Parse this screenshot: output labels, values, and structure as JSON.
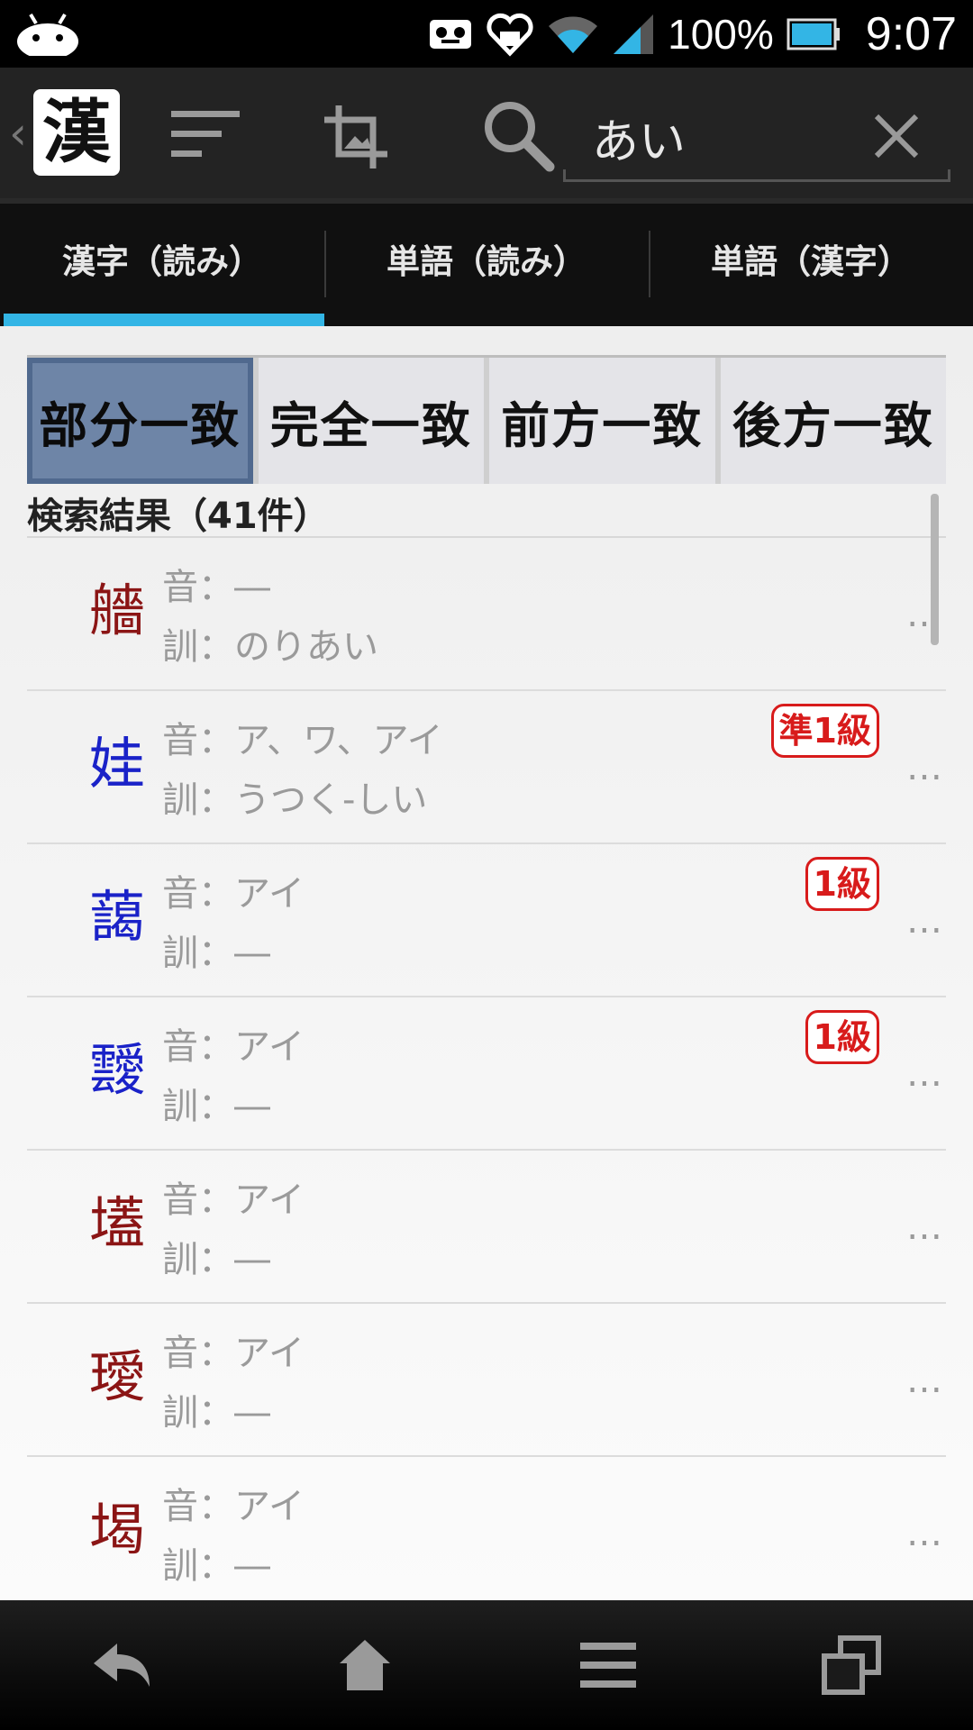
{
  "status_bar": {
    "battery_percent": "100%",
    "time": "9:07"
  },
  "action_bar": {
    "app_logo_char": "漢",
    "search": {
      "value": "あい"
    }
  },
  "tabs": [
    {
      "label": "漢字（読み）",
      "active": true
    },
    {
      "label": "単語（読み）",
      "active": false
    },
    {
      "label": "単語（漢字）",
      "active": false
    }
  ],
  "match_modes": [
    {
      "label": "部分一致",
      "selected": true
    },
    {
      "label": "完全一致",
      "selected": false
    },
    {
      "label": "前方一致",
      "selected": false
    },
    {
      "label": "後方一致",
      "selected": false
    }
  ],
  "results": {
    "count_label": "検索結果（41件）",
    "on_prefix": "音：",
    "kun_prefix": "訓：",
    "more_label": "…",
    "items": [
      {
        "kanji": "艢",
        "kanji_color": "red",
        "on": "―",
        "kun": "のりあい",
        "grade": ""
      },
      {
        "kanji": "娃",
        "kanji_color": "blue",
        "on": "ア、ワ、アイ",
        "kun": "うつく-しい",
        "grade": "準1級"
      },
      {
        "kanji": "藹",
        "kanji_color": "blue",
        "on": "アイ",
        "kun": "―",
        "grade": "1級"
      },
      {
        "kanji": "靉",
        "kanji_color": "blue",
        "on": "アイ",
        "kun": "―",
        "grade": "1級"
      },
      {
        "kanji": "壒",
        "kanji_color": "red",
        "on": "アイ",
        "kun": "―",
        "grade": ""
      },
      {
        "kanji": "璦",
        "kanji_color": "red",
        "on": "アイ",
        "kun": "―",
        "grade": ""
      },
      {
        "kanji": "堨",
        "kanji_color": "red",
        "on": "アイ",
        "kun": "―",
        "grade": ""
      }
    ]
  },
  "nav_bar": [
    "back-icon",
    "home-icon",
    "menu-icon",
    "recent-apps-icon"
  ]
}
